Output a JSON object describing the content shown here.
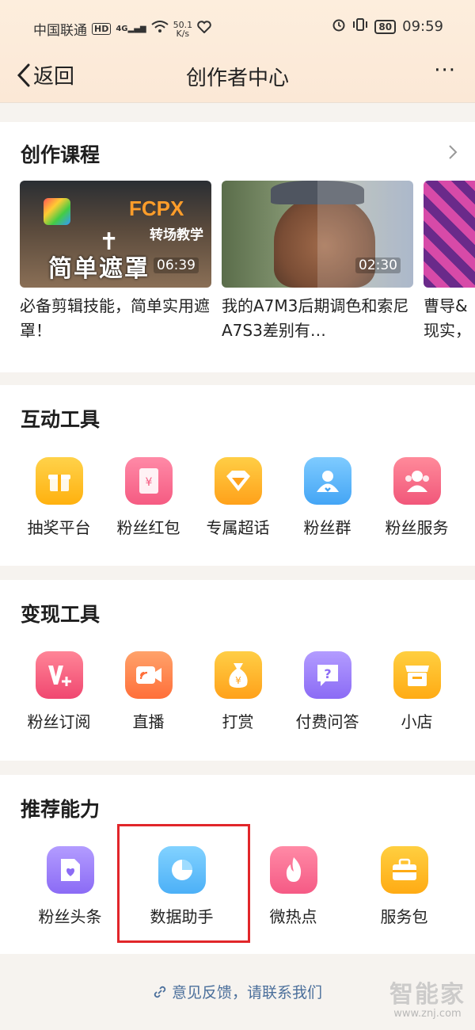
{
  "status_bar": {
    "carrier": "中国联通",
    "hd": "HD",
    "signal": "4G",
    "speed_value": "50.1",
    "speed_unit": "K/s",
    "battery": "80",
    "time": "09:59"
  },
  "nav": {
    "back_label": "返回",
    "title": "创作者中心",
    "more": "···"
  },
  "courses": {
    "title": "创作课程",
    "items": [
      {
        "title": "必备剪辑技能，简单实用遮罩！",
        "duration": "06:39",
        "thumb_text": {
          "brand": "FCPX",
          "subtitle": "转场教学",
          "headline": "简单遮罩"
        }
      },
      {
        "title": "我的A7M3后期调色和索尼A7S3差别有…",
        "duration": "02:30"
      },
      {
        "title": "曹导&现实，"
      }
    ]
  },
  "interactive_tools": {
    "title": "互动工具",
    "items": [
      {
        "label": "抽奖平台",
        "icon": "gift-icon"
      },
      {
        "label": "粉丝红包",
        "icon": "red-packet-icon"
      },
      {
        "label": "专属超话",
        "icon": "diamond-icon"
      },
      {
        "label": "粉丝群",
        "icon": "group-icon"
      },
      {
        "label": "粉丝服务",
        "icon": "fans-service-icon"
      }
    ]
  },
  "monetize_tools": {
    "title": "变现工具",
    "items": [
      {
        "label": "粉丝订阅",
        "icon": "subscribe-icon"
      },
      {
        "label": "直播",
        "icon": "live-icon"
      },
      {
        "label": "打赏",
        "icon": "money-bag-icon"
      },
      {
        "label": "付费问答",
        "icon": "question-icon"
      },
      {
        "label": "小店",
        "icon": "shop-icon"
      }
    ]
  },
  "recommend": {
    "title": "推荐能力",
    "items": [
      {
        "label": "粉丝头条",
        "icon": "headline-icon"
      },
      {
        "label": "数据助手",
        "icon": "pie-chart-icon"
      },
      {
        "label": "微热点",
        "icon": "flame-icon"
      },
      {
        "label": "服务包",
        "icon": "briefcase-icon"
      }
    ]
  },
  "feedback": {
    "text": "意见反馈，请联系我们"
  },
  "watermark": {
    "brand": "智能家",
    "url": "www.znj.com"
  },
  "colors": {
    "header_bg": "#fdeedd",
    "highlight_border": "#e1262a",
    "link": "#4b6f9b"
  }
}
